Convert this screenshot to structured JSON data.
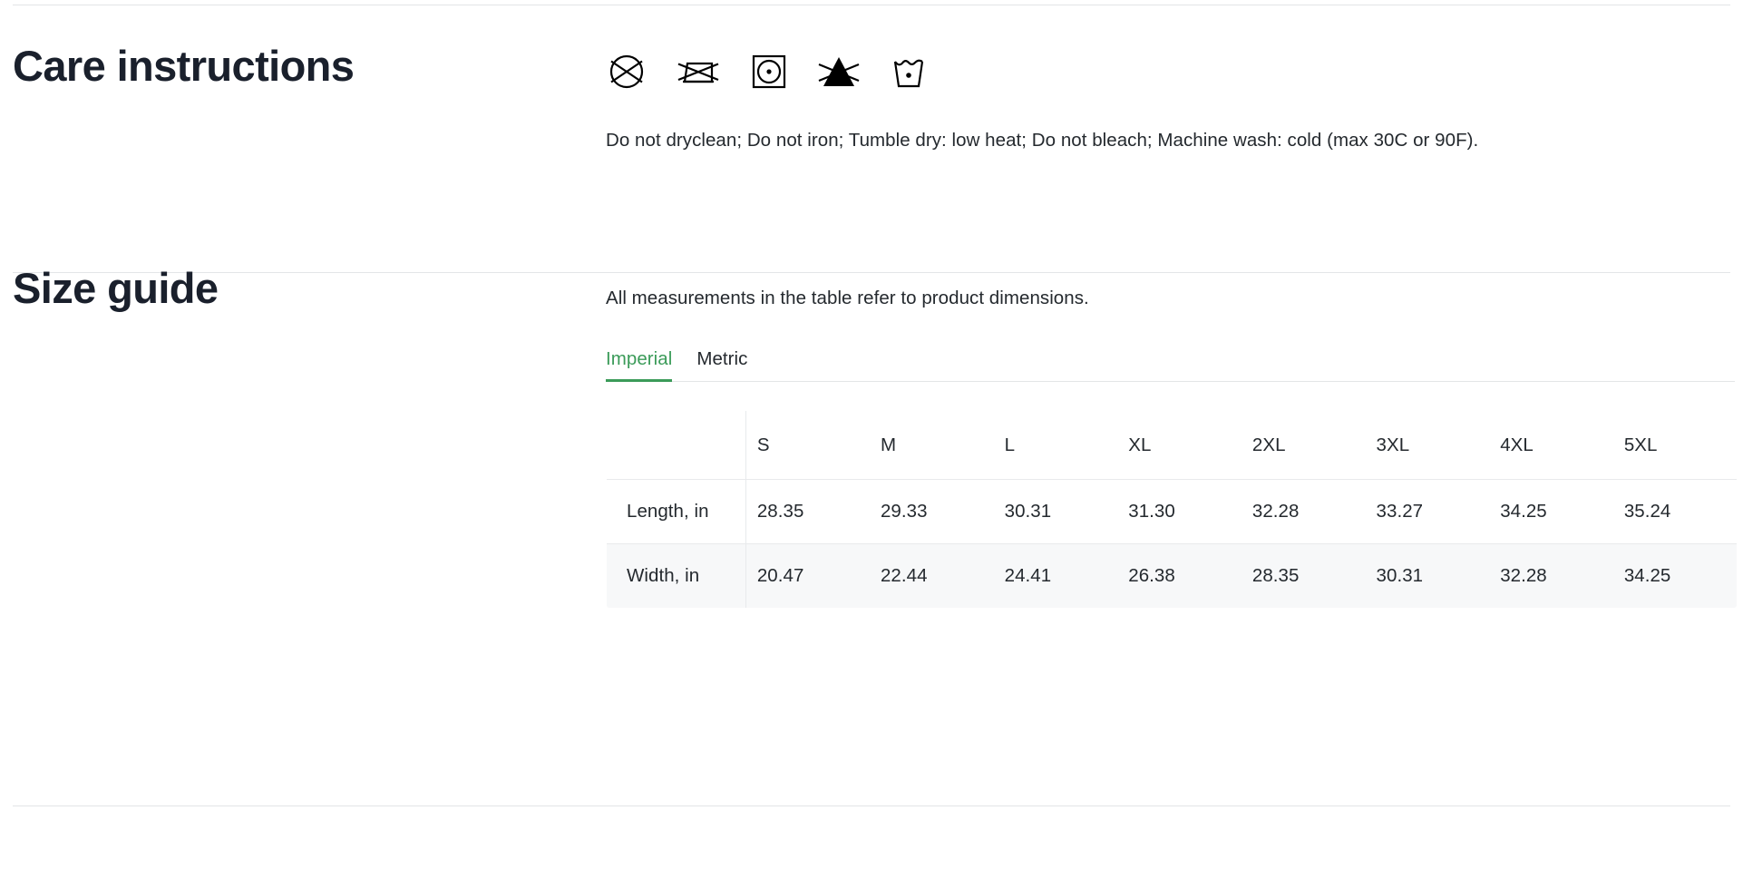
{
  "care": {
    "heading": "Care instructions",
    "icons": [
      {
        "name": "do-not-dryclean-icon",
        "label": "Do not dryclean"
      },
      {
        "name": "do-not-iron-icon",
        "label": "Do not iron"
      },
      {
        "name": "tumble-dry-low-heat-icon",
        "label": "Tumble dry: low heat"
      },
      {
        "name": "do-not-bleach-icon",
        "label": "Do not bleach"
      },
      {
        "name": "machine-wash-cold-icon",
        "label": "Machine wash: cold (max 30C or 90F)"
      }
    ],
    "description": "Do not dryclean; Do not iron; Tumble dry: low heat; Do not bleach; Machine wash: cold (max 30C or 90F)."
  },
  "size_guide": {
    "heading": "Size guide",
    "note": "All measurements in the table refer to product dimensions.",
    "tabs": [
      {
        "label": "Imperial",
        "active": true
      },
      {
        "label": "Metric",
        "active": false
      }
    ],
    "active_tab": "Imperial",
    "accent_color": "#3B9B59",
    "table": {
      "corner_label": "",
      "columns": [
        "S",
        "M",
        "L",
        "XL",
        "2XL",
        "3XL",
        "4XL",
        "5XL"
      ],
      "rows": [
        {
          "label": "Length, in",
          "values": [
            "28.35",
            "29.33",
            "30.31",
            "31.30",
            "32.28",
            "33.27",
            "34.25",
            "35.24"
          ]
        },
        {
          "label": "Width, in",
          "values": [
            "20.47",
            "22.44",
            "24.41",
            "26.38",
            "28.35",
            "30.31",
            "32.28",
            "34.25"
          ]
        }
      ]
    }
  }
}
